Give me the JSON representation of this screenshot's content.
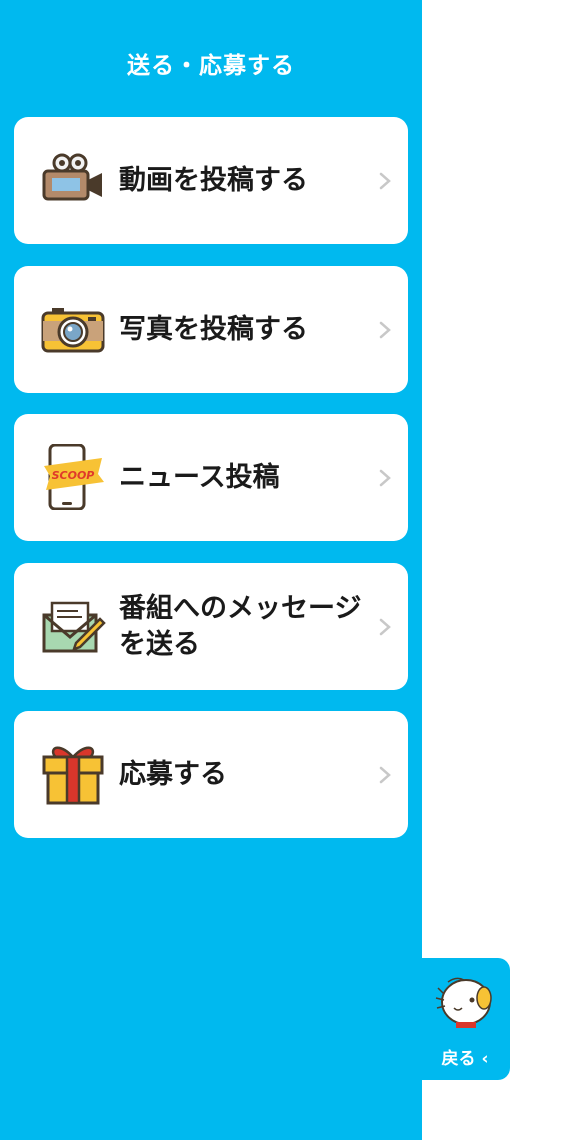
{
  "header": {
    "title": "送る・応募する"
  },
  "menu": {
    "items": [
      {
        "label": "動画を投稿する",
        "icon": "video-camera-icon"
      },
      {
        "label": "写真を投稿する",
        "icon": "camera-icon"
      },
      {
        "label": "ニュース投稿",
        "icon": "scoop-smartphone-icon",
        "icon_text": "SCOOP"
      },
      {
        "label_line1": "番組へのメッセージ",
        "label_line2": "を送る",
        "icon": "letter-pen-icon"
      },
      {
        "label": "応募する",
        "icon": "gift-box-icon"
      }
    ]
  },
  "back_tab": {
    "label": "戻る",
    "icon": "mascot-icon"
  },
  "colors": {
    "panel": "#00b9ef",
    "card": "#ffffff",
    "chevron": "#c8c8c8"
  }
}
